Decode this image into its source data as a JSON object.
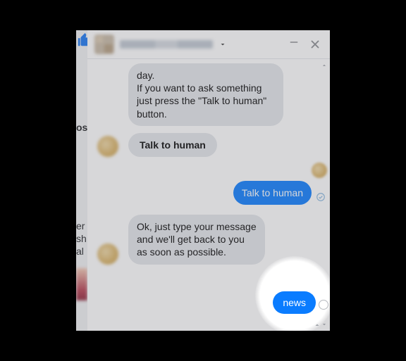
{
  "colors": {
    "accent": "#0a7cff",
    "incoming_bubble": "#e4e6eb"
  },
  "icons": {
    "like": "thumbs-up-icon",
    "chevron_down": "chevron-down-icon",
    "minimize": "minus-icon",
    "close": "close-icon",
    "scroll_up": "chevron-up-icon",
    "scroll_down": "chevron-down-icon",
    "seen": "check-circle-icon",
    "caret_up": "chevron-up-icon"
  },
  "background": {
    "truncated_labels": {
      "os": "os",
      "er": "er",
      "sh": "sh",
      "al": "al"
    }
  },
  "chat": {
    "messages": {
      "bot_intro": "day.\n If you want to ask something just press the \"Talk to human\" button.",
      "quick_reply_talk": "Talk to human",
      "user_talk": "Talk to human",
      "bot_ack": "Ok, just type your message and we'll get back to you as soon as possible.",
      "user_news": "news"
    }
  }
}
